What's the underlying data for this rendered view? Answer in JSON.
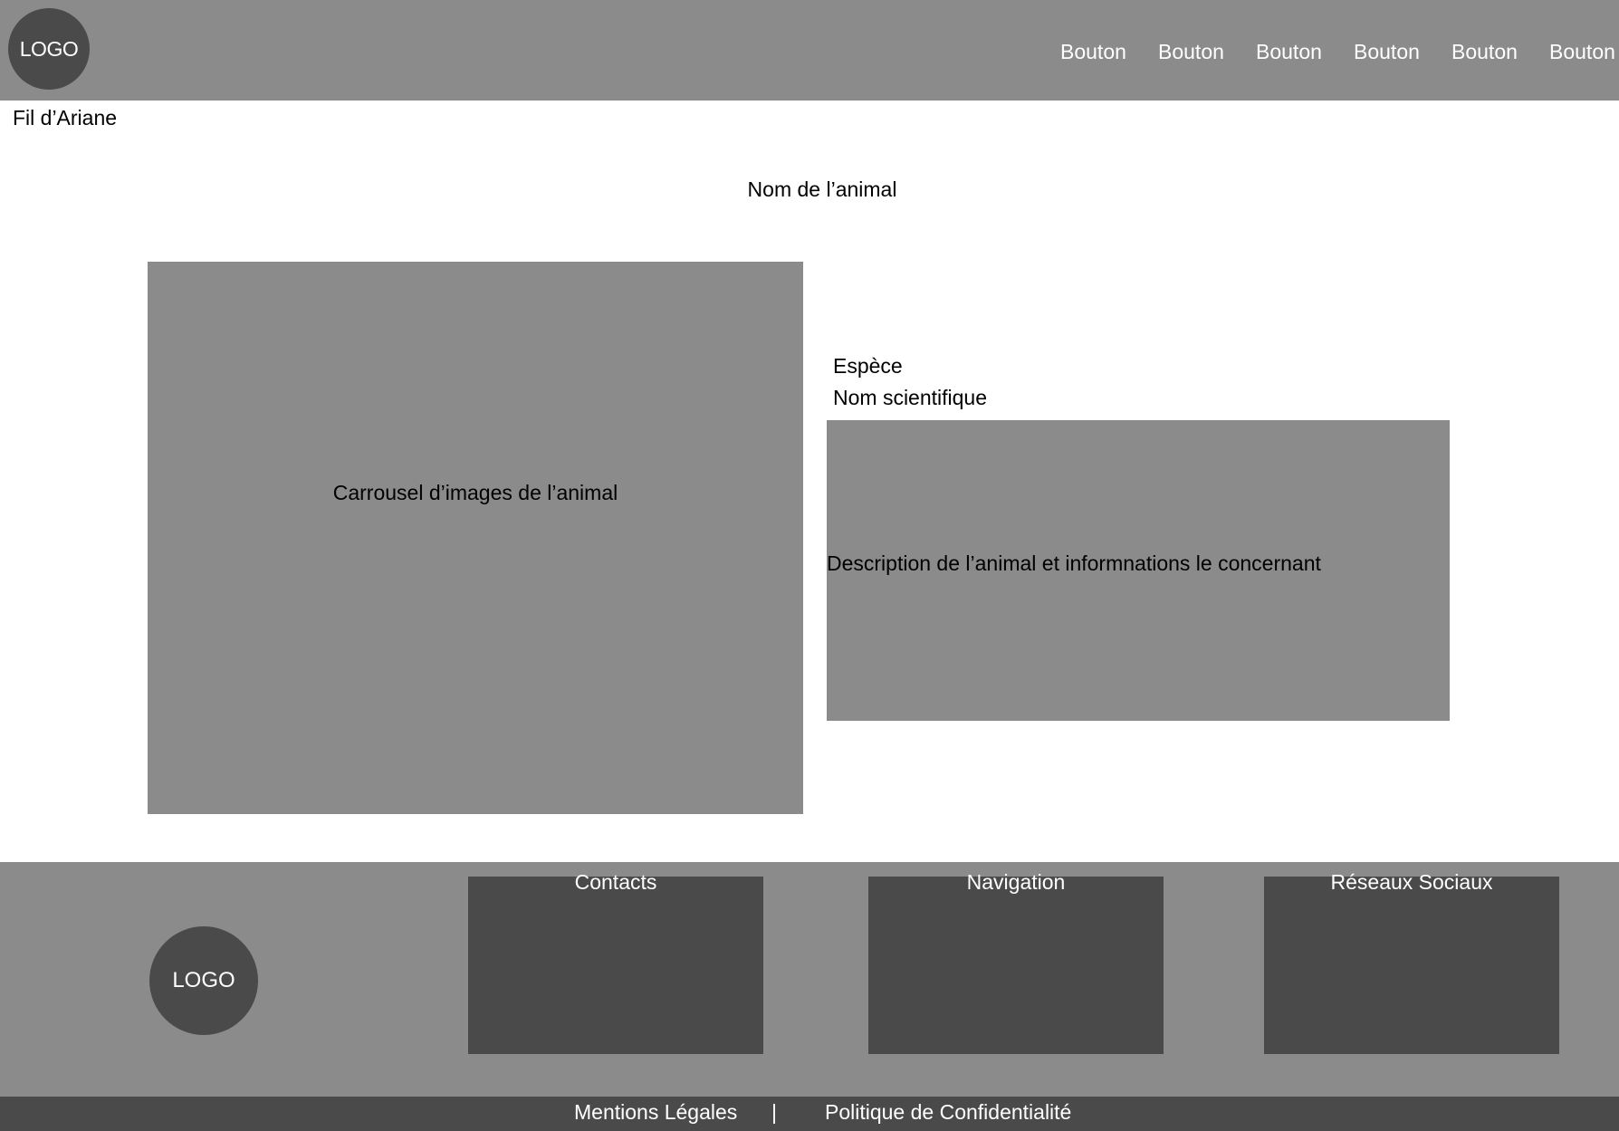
{
  "header": {
    "logo": "LOGO",
    "nav": [
      "Bouton",
      "Bouton",
      "Bouton",
      "Bouton",
      "Bouton",
      "Bouton"
    ]
  },
  "breadcrumb": "Fil d’Ariane",
  "page_title": "Nom de l’animal",
  "carousel": {
    "label": "Carrousel d’images de l’animal"
  },
  "info": {
    "species": "Espèce",
    "scientific_name": "Nom scientifique",
    "description": "Description de l’animal et informnations le concernant"
  },
  "footer": {
    "logo": "LOGO",
    "sections": [
      "Contacts",
      "Navigation",
      "Réseaux Sociaux"
    ]
  },
  "bottom_bar": {
    "legal": "Mentions Légales",
    "separator": "|",
    "privacy": "Politique de Confidentialité"
  },
  "colors": {
    "gray": "#8b8b8b",
    "dark_gray": "#4a4a4a",
    "background": "#ffffff"
  }
}
